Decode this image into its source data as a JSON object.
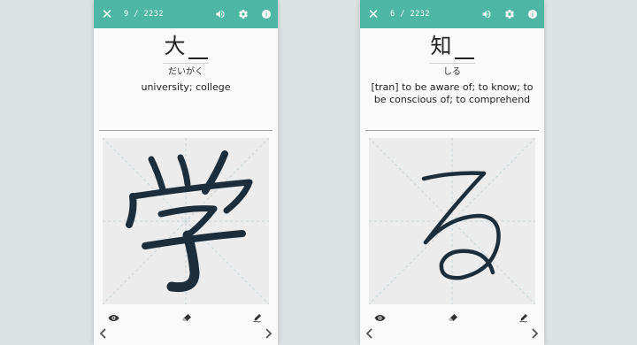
{
  "screens": [
    {
      "counter": "9 / 2232",
      "kanji": "大",
      "reading": "だいがく",
      "meaning": "university; college",
      "drawn_character": "学"
    },
    {
      "counter": "6 / 2232",
      "kanji": "知",
      "reading": "しる",
      "meaning": "[tran] to be aware of; to know; to be conscious of; to comprehend",
      "drawn_character": "る"
    }
  ],
  "icons": {
    "close": "close-icon",
    "volume": "volume-icon",
    "settings": "gear-icon",
    "info": "info-icon",
    "eye": "eye-icon",
    "eraser": "eraser-icon",
    "pen": "pen-icon",
    "prev": "chevron-left-icon",
    "next": "chevron-right-icon"
  },
  "colors": {
    "topbar": "#4db6a4",
    "ink": "#1c2e3c",
    "canvas": "#ececec",
    "guide": "#b8cfd6"
  }
}
